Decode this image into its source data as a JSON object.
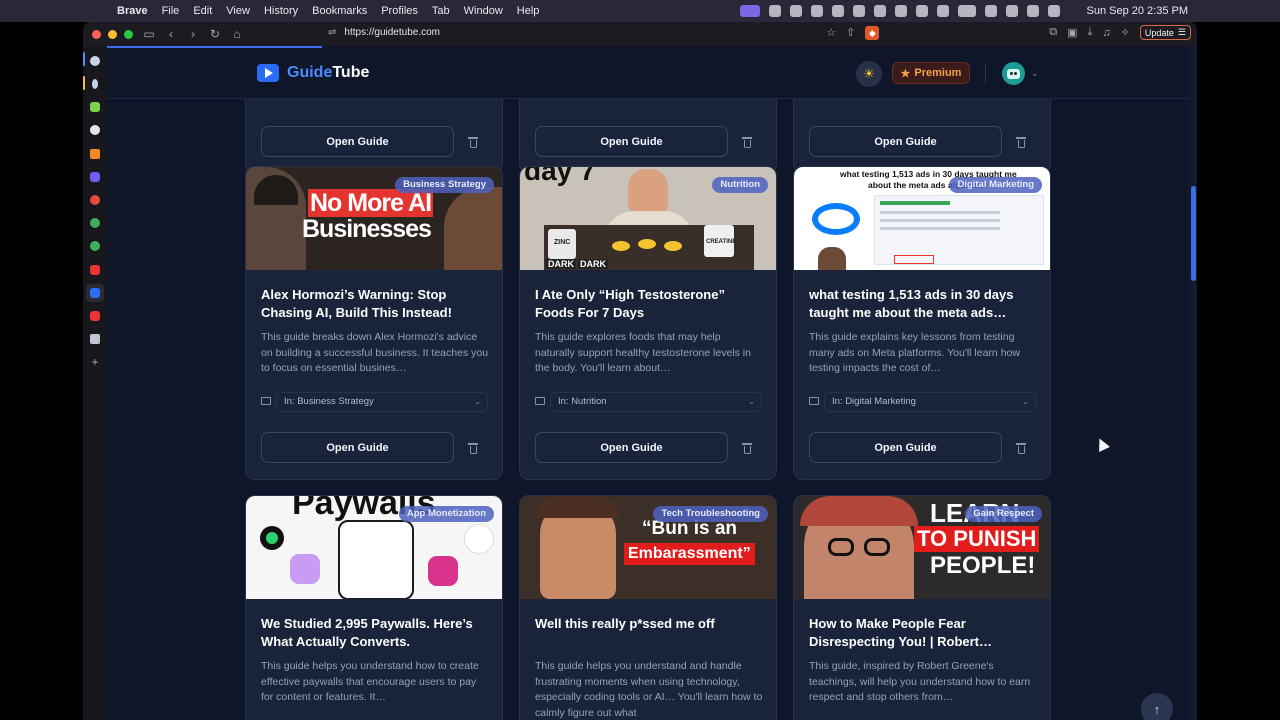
{
  "menubar": {
    "app": "Brave",
    "items": [
      "File",
      "Edit",
      "View",
      "History",
      "Bookmarks",
      "Profiles",
      "Tab",
      "Window",
      "Help"
    ],
    "clock": "Sun Sep 20  2:35 PM"
  },
  "browser": {
    "url": "https://guidetube.com",
    "update_label": "Update"
  },
  "site": {
    "logo_part1": "Guide",
    "logo_part2": "Tube",
    "premium_label": "Premium",
    "open_label": "Open Guide"
  },
  "cards": [
    {
      "category": "Business Strategy",
      "title": "Alex Hormozi’s Warning: Stop Chasing AI, Build This Instead!",
      "description": "This guide breaks down Alex Hormozi's advice on building a successful business. It teaches you to focus on essential busines…",
      "folder": "In: Business Strategy",
      "thumb_text": [
        "No More AI",
        "Businesses"
      ]
    },
    {
      "category": "Nutrition",
      "title": "I Ate Only “High Testosterone” Foods For 7 Days",
      "description": "This guide explores foods that may help naturally support healthy testosterone levels in the body. You'll learn about…",
      "folder": "In: Nutrition",
      "thumb_text": [
        "day 7",
        "ZINC",
        "DARK",
        "DARK",
        "CREATINE"
      ]
    },
    {
      "category": "Digital Marketing",
      "title": "what testing 1,513 ads in 30 days taught me about the meta ads…",
      "description": "This guide explains key lessons from testing many ads on Meta platforms. You'll learn how testing impacts the cost of…",
      "folder": "In: Digital Marketing",
      "thumb_text": [
        "what testing 1,513 ads in 30 days taught me",
        "about the meta ads algorithm"
      ]
    },
    {
      "category": "App Monetization",
      "title": "We Studied 2,995 Paywalls. Here’s What Actually Converts.",
      "description": "This guide helps you understand how to create effective paywalls that encourage users to pay for content or features. It…",
      "thumb_text": [
        "Paywalls"
      ]
    },
    {
      "category": "Tech Troubleshooting",
      "title": "Well this really p*ssed me off",
      "description": "This guide helps you understand and handle frustrating moments when using technology, especially coding tools or AI… You'll learn how to calmly figure out what",
      "thumb_text": [
        "“Bun is an",
        "Embarassment”"
      ]
    },
    {
      "category": "Gain Respect",
      "title": "How to Make People Fear Disrespecting You! | Robert…",
      "description": "This guide, inspired by Robert Greene's teachings, will help you understand how to earn respect and stop others from…",
      "thumb_text": [
        "LEARN",
        "TO PUNISH",
        "PEOPLE!"
      ]
    }
  ],
  "colors": {
    "page_bg": "#0f1629",
    "card_bg": "#19233a",
    "accent": "#2b6cf6",
    "premium": "#f4a14a"
  }
}
